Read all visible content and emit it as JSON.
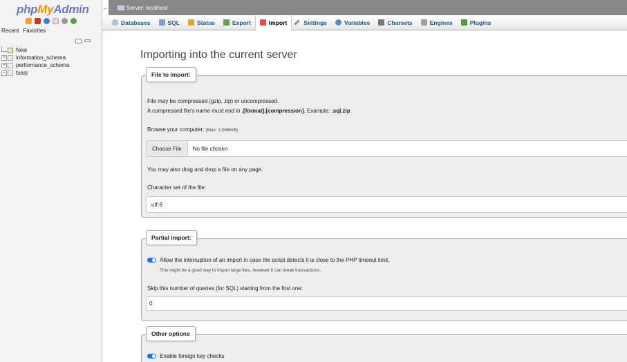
{
  "nav": {
    "logo": {
      "php": "php",
      "my": "My",
      "admin": "Admin"
    },
    "quick_icons": [
      "home-icon",
      "db-icon",
      "help-icon",
      "docs-icon",
      "settings-icon",
      "reload-icon"
    ],
    "tabs": [
      "Recent",
      "Favorites"
    ],
    "tree": [
      {
        "label": "New",
        "kind": "new"
      },
      {
        "label": "information_schema",
        "kind": "db"
      },
      {
        "label": "performance_schema",
        "kind": "db"
      },
      {
        "label": "tuasi",
        "kind": "db"
      }
    ]
  },
  "serverbar": {
    "label": "Server: localhost"
  },
  "menu": [
    {
      "label": "Databases",
      "icon": "databases-icon",
      "color": "#b9c1cc"
    },
    {
      "label": "SQL",
      "icon": "sql-icon",
      "color": "#7ea0c8"
    },
    {
      "label": "Status",
      "icon": "status-icon",
      "color": "#e1a43a"
    },
    {
      "label": "Export",
      "icon": "export-icon",
      "color": "#6c9d54"
    },
    {
      "label": "Import",
      "icon": "import-icon",
      "color": "#d9534f",
      "active": true
    },
    {
      "label": "Settings",
      "icon": "wrench-icon",
      "color": "#8a8fa3"
    },
    {
      "label": "Variables",
      "icon": "variables-icon",
      "color": "#5b8cc6"
    },
    {
      "label": "Charsets",
      "icon": "charsets-icon",
      "color": "#777777"
    },
    {
      "label": "Engines",
      "icon": "engines-icon",
      "color": "#a0a0a0"
    },
    {
      "label": "Plugins",
      "icon": "plugins-icon",
      "color": "#4e9a3b"
    }
  ],
  "main": {
    "title": "Importing into the current server",
    "file_section": {
      "legend": "File to import:",
      "line1": "File may be compressed (gzip, zip) or uncompressed.",
      "line2_prefix": "A compressed file's name must end in ",
      "line2_format": ".[format].[compression]",
      "line2_mid": ". Example: ",
      "line2_example": ".sql.zip",
      "browse_label": "Browse your computer:",
      "browse_max": "(Max: 2,048KiB)",
      "choose_button": "Choose File",
      "no_file": "No file chosen",
      "drag_drop": "You may also drag and drop a file on any page.",
      "charset_label": "Character set of the file:",
      "charset_value": "utf-8"
    },
    "partial_section": {
      "legend": "Partial import:",
      "allow_label": "Allow the interruption of an import in case the script detects it is close to the PHP timeout limit.",
      "allow_note": "This might be a good way to import large files, however it can break transactions.",
      "skip_label": "Skip this number of queries (for SQL) starting from the first one:",
      "skip_value": "0"
    },
    "other_section": {
      "legend": "Other options",
      "fk_label": "Enable foreign key checks"
    }
  },
  "colors": {
    "toggle": "#1f6fe0",
    "link": "#235a81",
    "serverbar": "#888888"
  }
}
